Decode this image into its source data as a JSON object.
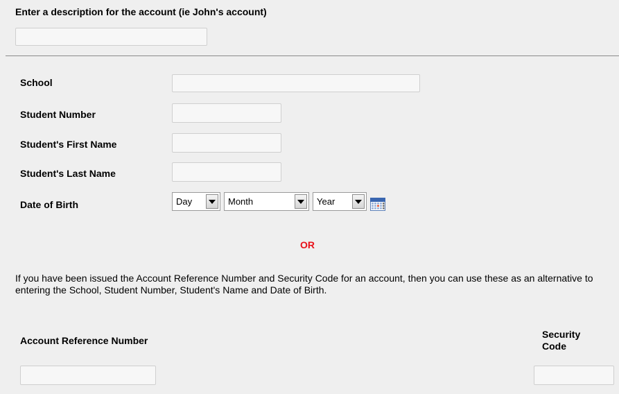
{
  "description": {
    "label": "Enter a description for the account (ie John's account)",
    "value": ""
  },
  "form": {
    "school_label": "School",
    "school_value": "",
    "student_number_label": "Student Number",
    "student_number_value": "",
    "first_name_label": "Student's First Name",
    "first_name_value": "",
    "last_name_label": "Student's Last Name",
    "last_name_value": "",
    "dob_label": "Date of Birth",
    "dob_day": "Day",
    "dob_month": "Month",
    "dob_year": "Year"
  },
  "or_text": "OR",
  "info_text": "If you have been issued the Account Reference Number and Security Code for an account, then you can use these as an alternative to entering the School, Student Number, Student's Name and Date of Birth.",
  "alternative": {
    "account_ref_label": "Account Reference Number",
    "account_ref_value": "",
    "security_code_label": "Security Code",
    "security_code_value": ""
  },
  "icons": {
    "calendar": "calendar-icon",
    "dropdown": "chevron-down-icon"
  },
  "colors": {
    "background": "#efefef",
    "or_text": "#e8111a",
    "input_border": "#cfcfcf",
    "divider": "#8a8a8a"
  }
}
